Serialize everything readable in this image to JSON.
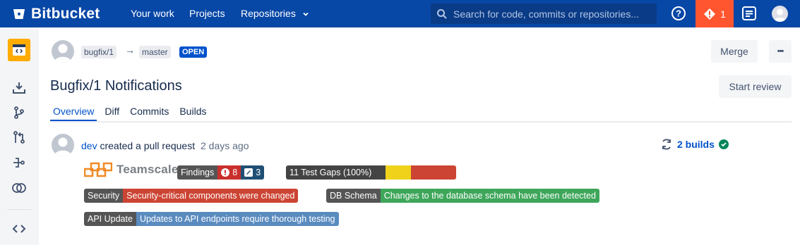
{
  "topnav": {
    "brand": "Bitbucket",
    "links": [
      "Your work",
      "Projects",
      "Repositories"
    ],
    "search_placeholder": "Search for code, commits or repositories...",
    "alert_count": "1"
  },
  "pr": {
    "source_branch": "bugfix/1",
    "arrow": "→",
    "target_branch": "master",
    "status": "OPEN",
    "title": "Bugfix/1 Notifications",
    "merge_label": "Merge",
    "more_label": "•••",
    "start_review_label": "Start review",
    "tabs": [
      "Overview",
      "Diff",
      "Commits",
      "Builds"
    ]
  },
  "activity": {
    "user": "dev",
    "action": "created a pull request",
    "time": "2 days ago",
    "builds_label": "2 builds"
  },
  "teamscale": {
    "brand": "Teamscale",
    "findings_label": "Findings",
    "findings_red": "8",
    "findings_blue": "3",
    "test_gaps_label": "11 Test Gaps (100%)",
    "test_gaps_fill": [
      0.0,
      0.36,
      1.0
    ]
  },
  "badges": [
    {
      "key": "Security",
      "value": "Security-critical components were changed",
      "color": "#cc4433"
    },
    {
      "key": "DB Schema",
      "value": "Changes to the database schema have been detected",
      "color": "#3ea65a"
    },
    {
      "key": "API Update",
      "value": "Updates to API endpoints require thorough testing",
      "color": "#5a8bbf"
    }
  ],
  "colors": {
    "nav": "#0747a6",
    "alert": "#ff5630",
    "accent": "#0052cc",
    "repo_icon": "#ffab00"
  }
}
